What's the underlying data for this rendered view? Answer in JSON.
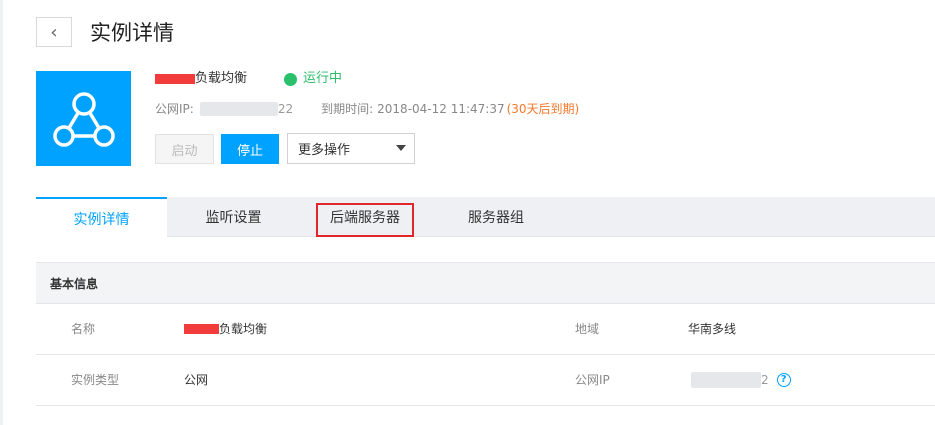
{
  "header": {
    "back_glyph": "‹",
    "title": "实例详情"
  },
  "instance": {
    "name_suffix": "负载均衡",
    "status": "运行中",
    "public_ip_label": "公网IP:",
    "public_ip_tail": "22",
    "expiry_label": "到期时间:",
    "expiry_value": "2018-04-12 11:47:37",
    "expiry_note": "(30天后到期)",
    "logo_icon": "network-share-icon"
  },
  "actions": {
    "start_label": "启动",
    "stop_label": "停止",
    "more_label": "更多操作"
  },
  "tabs": [
    {
      "label": "实例详情",
      "active": true
    },
    {
      "label": "监听设置",
      "active": false
    },
    {
      "label": "后端服务器",
      "active": false,
      "highlighted": true
    },
    {
      "label": "服务器组",
      "active": false
    }
  ],
  "basic_info": {
    "title": "基本信息",
    "rows": [
      {
        "left_label": "名称",
        "left_value_suffix": "负载均衡",
        "right_label": "地域",
        "right_value": "华南多线"
      },
      {
        "left_label": "实例类型",
        "left_value": "公网",
        "right_label": "公网IP",
        "right_value_tail": "2"
      }
    ]
  },
  "colors": {
    "accent": "#00a2ff",
    "running": "#2bc06b",
    "warning": "#f5782a",
    "highlight_box": "#e0252b",
    "redaction": "#f23b3b"
  }
}
